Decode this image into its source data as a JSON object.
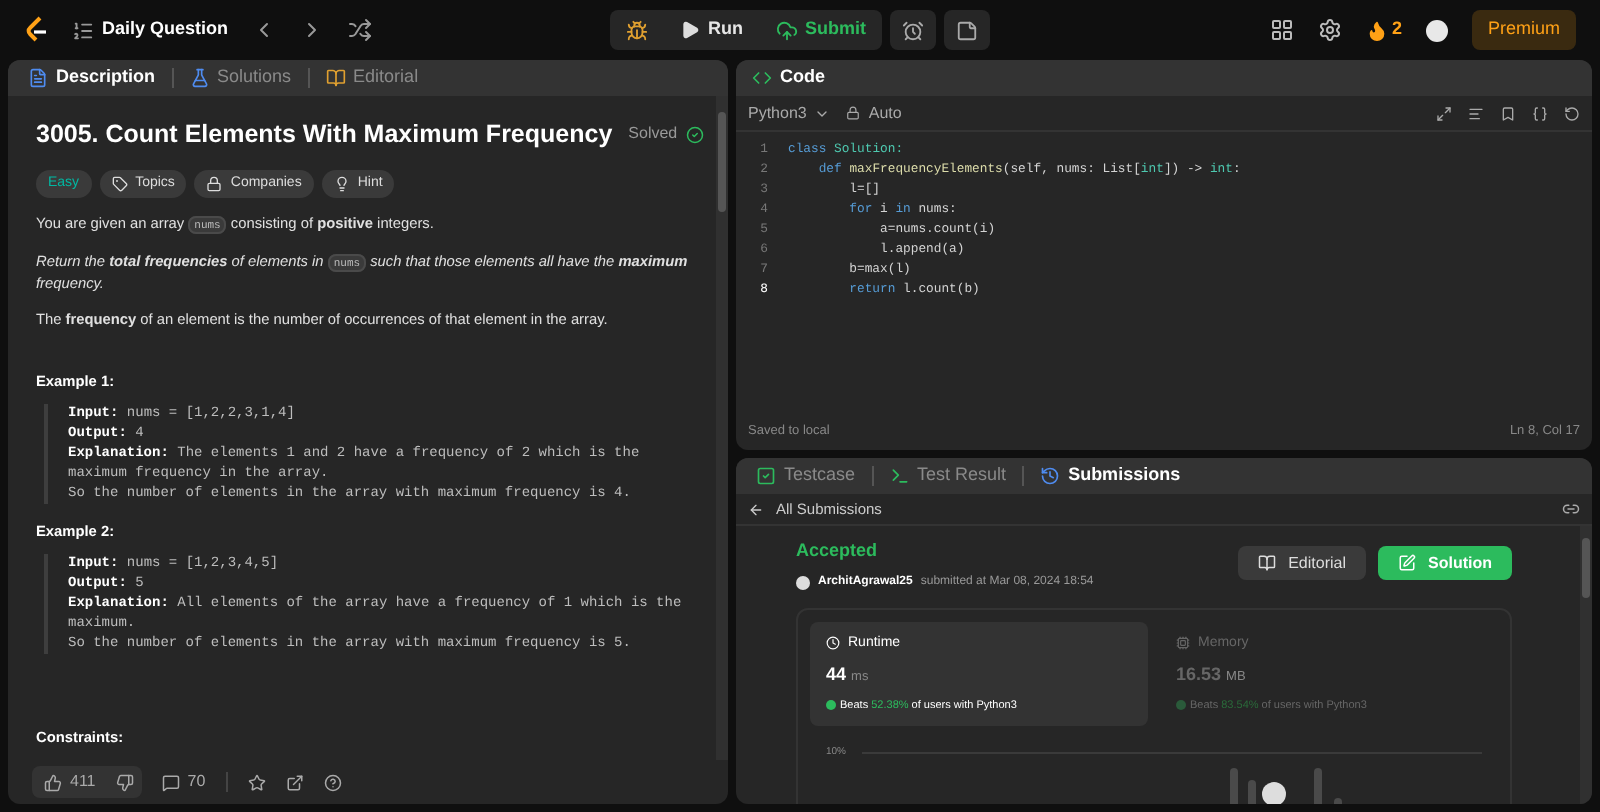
{
  "topbar": {
    "title": "Daily Question",
    "run": "Run",
    "submit": "Submit",
    "streak": "2",
    "premium": "Premium"
  },
  "description_tabs": [
    {
      "label": "Description",
      "selected": true,
      "kind": "description"
    },
    {
      "label": "Solutions",
      "selected": false,
      "kind": "solutions"
    },
    {
      "label": "Editorial",
      "selected": false,
      "kind": "editorial"
    }
  ],
  "problem": {
    "title": "3005. Count Elements With Maximum Frequency",
    "status": "Solved",
    "difficulty": "Easy",
    "chips": [
      {
        "label": "Topics",
        "kind": "topics"
      },
      {
        "label": "Companies",
        "kind": "companies"
      },
      {
        "label": "Hint",
        "kind": "hint"
      }
    ],
    "paragraphs": [
      [
        {
          "kind": "text",
          "text": "You are given an array "
        },
        {
          "kind": "code",
          "text": "nums"
        },
        {
          "kind": "text",
          "text": " consisting of **positive** integers."
        }
      ],
      [
        {
          "kind": "italic",
          "text": "Return the **total frequencies** of elements in "
        },
        {
          "kind": "code",
          "text": "nums"
        },
        {
          "kind": "italic",
          "text": " such that those elements all have the **maximum** frequency."
        }
      ],
      [
        {
          "kind": "text",
          "text": "The **frequency** of an element is the number of occurrences of that element in the array."
        }
      ]
    ],
    "examples": [
      {
        "title": "Example 1:",
        "lines": [
          "**Input:** nums = [1,2,2,3,1,4]",
          "**Output:** 4",
          "**Explanation:** The elements 1 and 2 have a frequency of 2 which is the maximum frequency in the array.",
          "So the number of elements in the array with maximum frequency is 4."
        ]
      },
      {
        "title": "Example 2:",
        "lines": [
          "**Input:** nums = [1,2,3,4,5]",
          "**Output:** 5",
          "**Explanation:** All elements of the array have a frequency of 1 which is the maximum.",
          "So the number of elements in the array with maximum frequency is 5."
        ]
      }
    ],
    "constraints_title": "Constraints:",
    "likes": "411",
    "comments": "70"
  },
  "code_panel": {
    "title": "Code",
    "language": "Python3",
    "mode": "Auto",
    "lines": [
      [
        {
          "kind": "keyword",
          "text": "class "
        },
        {
          "kind": "type",
          "text": "Solution:"
        }
      ],
      [
        {
          "kind": "keyword",
          "text": "    def "
        },
        {
          "kind": "function",
          "text": "maxFrequencyElements"
        },
        {
          "kind": "plain",
          "text": "(self, nums: List["
        },
        {
          "kind": "type",
          "text": "int"
        },
        {
          "kind": "plain",
          "text": "]) -> "
        },
        {
          "kind": "type",
          "text": "int"
        },
        {
          "kind": "plain",
          "text": ":"
        }
      ],
      [
        {
          "kind": "plain",
          "text": "        l=[]"
        }
      ],
      [
        {
          "kind": "keyword",
          "text": "        for "
        },
        {
          "kind": "plain",
          "text": "i "
        },
        {
          "kind": "keyword",
          "text": "in "
        },
        {
          "kind": "plain",
          "text": "nums:"
        }
      ],
      [
        {
          "kind": "plain",
          "text": "            a=nums.count(i)"
        }
      ],
      [
        {
          "kind": "plain",
          "text": "            l.append(a)"
        }
      ],
      [
        {
          "kind": "plain",
          "text": "        b=max(l)"
        }
      ],
      [
        {
          "kind": "keyword",
          "text": "        return "
        },
        {
          "kind": "plain",
          "text": "l.count(b)"
        }
      ]
    ],
    "line_numbers": [
      "1",
      "2",
      "3",
      "4",
      "5",
      "6",
      "7",
      "8"
    ],
    "saved": "Saved to local",
    "cursor": "Ln 8, Col 17"
  },
  "bottom_tabs": [
    {
      "label": "Testcase",
      "selected": false,
      "kind": "testcase"
    },
    {
      "label": "Test Result",
      "selected": false,
      "kind": "result"
    },
    {
      "label": "Submissions",
      "selected": true,
      "kind": "submissions"
    }
  ],
  "submission": {
    "back": "All Submissions",
    "status": "Accepted",
    "user": "ArchitAgrawal25",
    "submitted": "submitted at Mar 08, 2024 18:54",
    "editorial": "Editorial",
    "solution": "Solution",
    "cards": [
      {
        "kind": "runtime",
        "label": "Runtime",
        "value": "44",
        "unit": "ms",
        "beats": "Beats",
        "percent": "52.38%",
        "suffix": "of users with Python3",
        "selected": true
      },
      {
        "kind": "memory",
        "label": "Memory",
        "value": "16.53",
        "unit": "MB",
        "beats": "Beats",
        "percent": "83.54%",
        "suffix": "of users with Python3",
        "selected": false
      }
    ],
    "chart_label": "10%"
  }
}
